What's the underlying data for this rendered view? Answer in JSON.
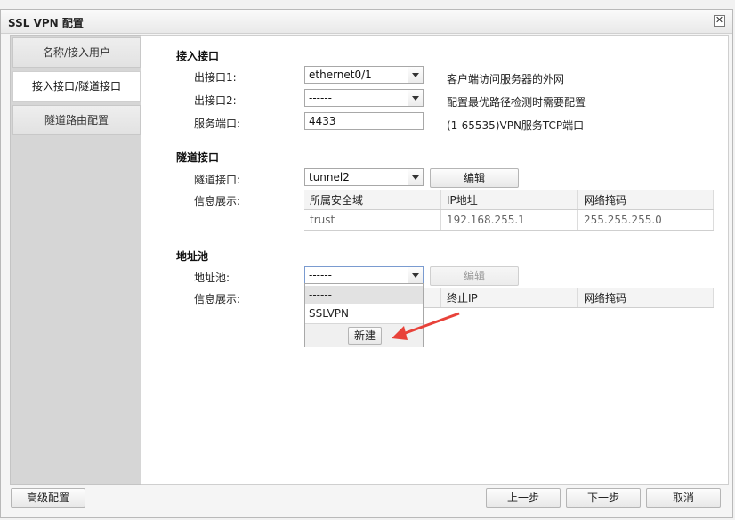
{
  "window": {
    "title": "SSL VPN 配置"
  },
  "nav": {
    "items": [
      {
        "label": "名称/接入用户"
      },
      {
        "label": "接入接口/隧道接口"
      },
      {
        "label": "隧道路由配置"
      }
    ]
  },
  "access": {
    "title": "接入接口",
    "exit1_label": "出接口1:",
    "exit1_value": "ethernet0/1",
    "exit1_hint": "客户端访问服务器的外网",
    "exit2_label": "出接口2:",
    "exit2_value": "------",
    "exit2_hint": "配置最优路径检测时需要配置",
    "port_label": "服务端口:",
    "port_value": "4433",
    "port_hint": "(1-65535)VPN服务TCP端口"
  },
  "tunnel": {
    "title": "隧道接口",
    "iface_label": "隧道接口:",
    "iface_value": "tunnel2",
    "edit_label": "编辑",
    "info_label": "信息展示:",
    "table": {
      "headers": [
        "所属安全域",
        "IP地址",
        "网络掩码"
      ],
      "rows": [
        [
          "trust",
          "192.168.255.1",
          "255.255.255.0"
        ]
      ]
    }
  },
  "pool": {
    "title": "地址池",
    "pool_label": "地址池:",
    "pool_value": "------",
    "edit_label": "编辑",
    "info_label": "信息展示:",
    "table_headers": [
      "终止IP",
      "网络掩码"
    ],
    "dropdown": {
      "options": [
        "------",
        "SSLVPN"
      ],
      "new_label": "新建"
    }
  },
  "footer": {
    "advanced": "高级配置",
    "prev": "上一步",
    "next": "下一步",
    "cancel": "取消"
  },
  "colors": {
    "annotation_arrow": "#e8423a"
  }
}
